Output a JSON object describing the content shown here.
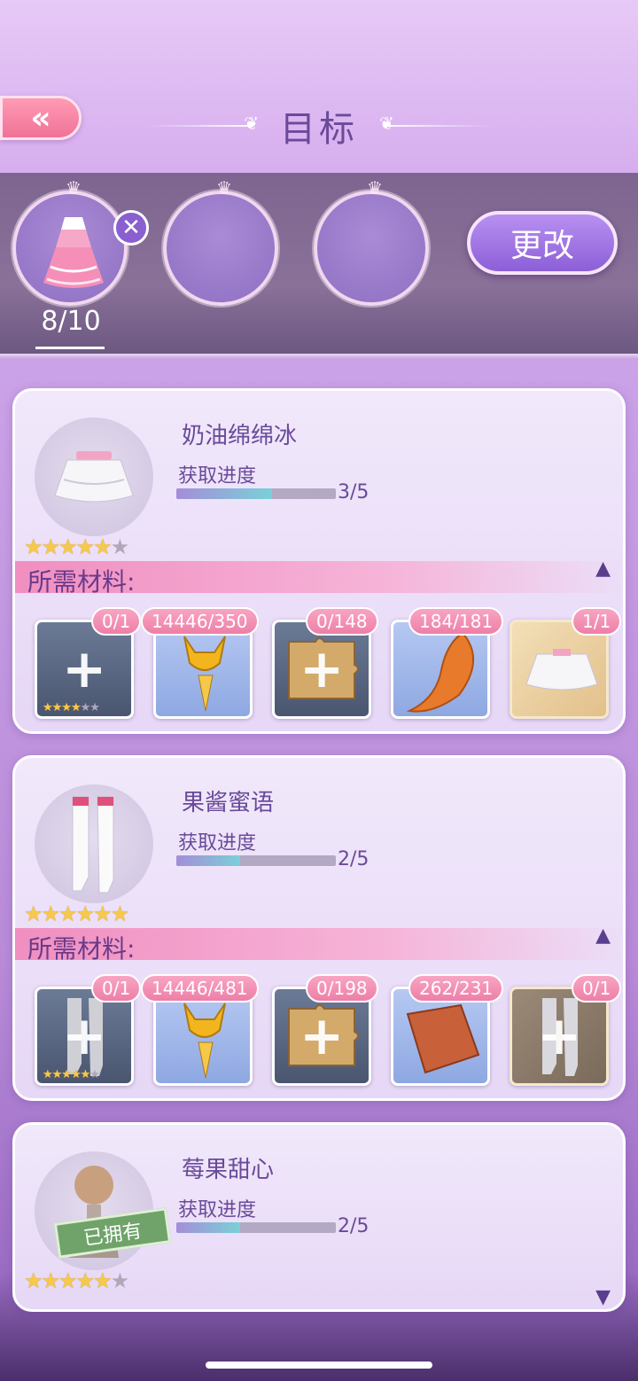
{
  "header": {
    "title": "目标",
    "back_icon": "double-chevron-left-icon"
  },
  "target_slots": {
    "count": "8/10",
    "change_label": "更改"
  },
  "items": [
    {
      "name": "奶油绵绵冰",
      "progress_label": "获取进度",
      "progress_text": "3/5",
      "progress": 0.6,
      "stars": 5,
      "materials_label": "所需材料:",
      "materials": [
        {
          "count": "0/1"
        },
        {
          "count": "14446/350"
        },
        {
          "count": "0/148"
        },
        {
          "count": "184/181"
        },
        {
          "count": "1/1"
        }
      ]
    },
    {
      "name": "果酱蜜语",
      "progress_label": "获取进度",
      "progress_text": "2/5",
      "progress": 0.4,
      "stars": 6,
      "materials_label": "所需材料:",
      "materials": [
        {
          "count": "0/1"
        },
        {
          "count": "14446/481"
        },
        {
          "count": "0/198"
        },
        {
          "count": "262/231"
        },
        {
          "count": "0/1"
        }
      ]
    },
    {
      "name": "莓果甜心",
      "progress_label": "获取进度",
      "progress_text": "2/5",
      "progress": 0.4,
      "stars": 5,
      "owned_label": "已拥有"
    }
  ],
  "colors": {
    "accent": "#8c5fd8",
    "badge": "#ee7fa8",
    "star": "#f7c94a"
  }
}
